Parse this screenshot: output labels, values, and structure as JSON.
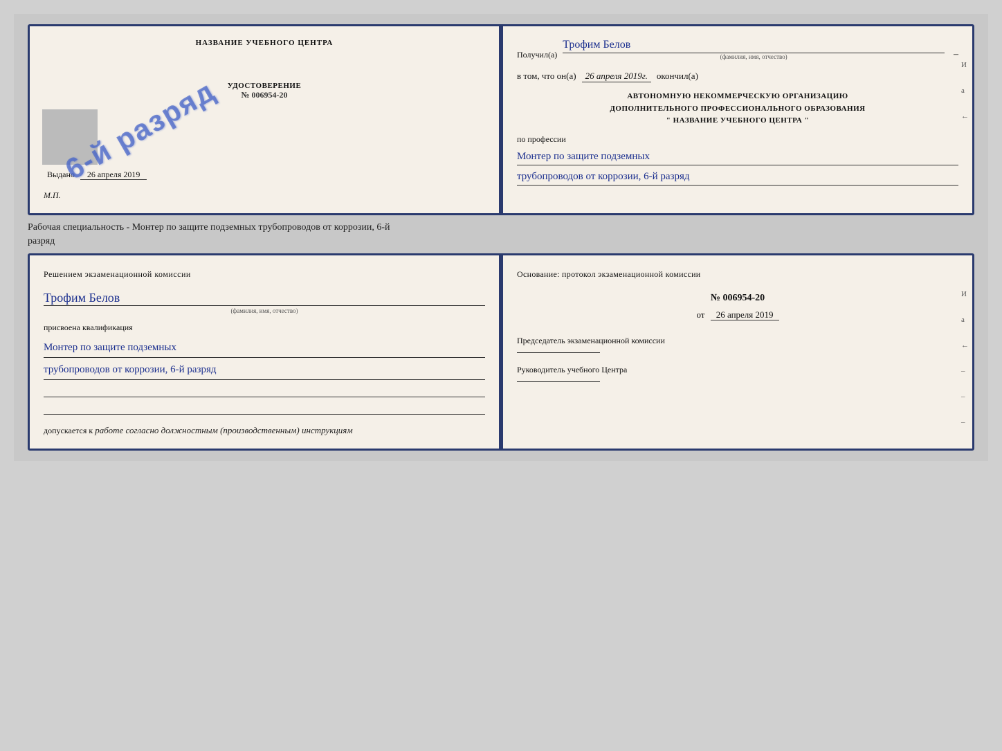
{
  "top_cert": {
    "left": {
      "title": "НАЗВАНИЕ УЧЕБНОГО ЦЕНТРА",
      "stamp_text": "6-й разряд",
      "doc_section": "УДОСТОВЕРЕНИЕ",
      "doc_number": "№ 006954-20",
      "issued_label": "Выдано",
      "issued_date": "26 апреля 2019",
      "mp": "М.П."
    },
    "right": {
      "received_label": "Получил(а)",
      "received_name": "Трофим Белов",
      "received_sub": "(фамилия, имя, отчество)",
      "dash": "–",
      "date_label": "в том, что он(а)",
      "date_value": "26 апреля 2019г.",
      "completed_label": "окончил(а)",
      "org_line1": "АВТОНОМНУЮ НЕКОММЕРЧЕСКУЮ ОРГАНИЗАЦИЮ",
      "org_line2": "ДОПОЛНИТЕЛЬНОГО ПРОФЕССИОНАЛЬНОГО ОБРАЗОВАНИЯ",
      "org_line3": "\"   НАЗВАНИЕ УЧЕБНОГО ЦЕНТРА   \"",
      "profession_label": "по профессии",
      "profession_line1": "Монтер по защите подземных",
      "profession_line2": "трубопроводов от коррозии, 6-й разряд",
      "side_chars": [
        "И",
        "а",
        "←",
        "–",
        "–",
        "–"
      ]
    }
  },
  "caption": "Рабочая специальность - Монтер по защите подземных трубопроводов от коррозии, 6-й\nразряд",
  "bottom_cert": {
    "left": {
      "section_title": "Решением экзаменационной комиссии",
      "name": "Трофим Белов",
      "name_sub": "(фамилия, имя, отчество)",
      "assigned_label": "присвоена квалификация",
      "qualification_line1": "Монтер по защите подземных",
      "qualification_line2": "трубопроводов от коррозии, 6-й разряд",
      "допускается_label": "допускается к",
      "допускается_value": "работе согласно должностным (производственным) инструкциям"
    },
    "right": {
      "osnov_label": "Основание: протокол экзаменационной комиссии",
      "number": "№ 006954-20",
      "date_prefix": "от",
      "date_value": "26 апреля 2019",
      "chairman_title": "Председатель экзаменационной комиссии",
      "director_title": "Руководитель учебного Центра",
      "side_chars": [
        "И",
        "а",
        "←",
        "–",
        "–",
        "–",
        "–",
        "–"
      ]
    }
  }
}
